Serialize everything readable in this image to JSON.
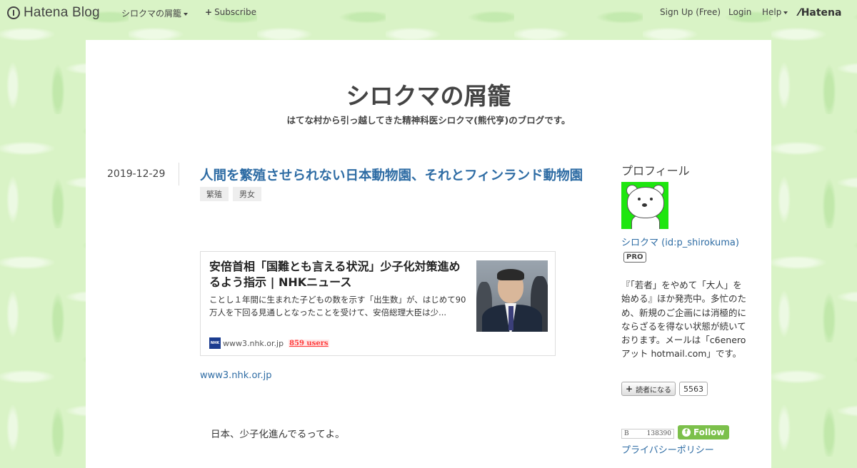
{
  "topbar": {
    "logo_text": "Hatena Blog",
    "blog_menu_label": "シロクマの屑籠",
    "subscribe_label": "Subscribe",
    "signup_label": "Sign Up (Free)",
    "login_label": "Login",
    "help_label": "Help",
    "hatena_label": "Hatena"
  },
  "header": {
    "title": "シロクマの屑籠",
    "description": "はてな村から引っ越してきた精神科医シロクマ(熊代亨)のブログです。"
  },
  "entry": {
    "date": "2019-12-29",
    "title": "人間を繁殖させられない日本動物園、それとフィンランド動物園",
    "tags": [
      "繁殖",
      "男女"
    ],
    "card": {
      "title": "安倍首相「国難とも言える状況」少子化対策進めるよう指示 | NHKニュース",
      "description": "ことし１年間に生まれた子どもの数を示す「出生数」が、はじめて90万人を下回る見通しとなったことを受けて、安倍総理大臣は少...",
      "site_icon_text": "NHK",
      "domain": "www3.nhk.or.jp",
      "users": "859 users"
    },
    "source_link": "www3.nhk.or.jp",
    "body_first_line": "日本、少子化進んでるってよ。"
  },
  "sidebar": {
    "profile_heading": "プロフィール",
    "name": "シロクマ (id:p_shirokuma)",
    "pro_badge": "PRO",
    "bio": "『「若者」をやめて「大人」を始める』ほか発売中。多忙のため、新規のご企画には消極的にならざるを得ない状態が続いております。メールは「c6eneroアット hotmail.com」です。",
    "reader_button": "読者になる",
    "reader_count": "5563",
    "bookmark_icon": "B",
    "bookmark_count": "138390",
    "follow_label": "Follow",
    "privacy_link": "プライバシーポリシー"
  },
  "colors": {
    "link_blue": "#2e6ca4",
    "background_green": "#d9f3c6",
    "follow_green": "#7cc04b",
    "users_red": "#ff3b3b"
  }
}
